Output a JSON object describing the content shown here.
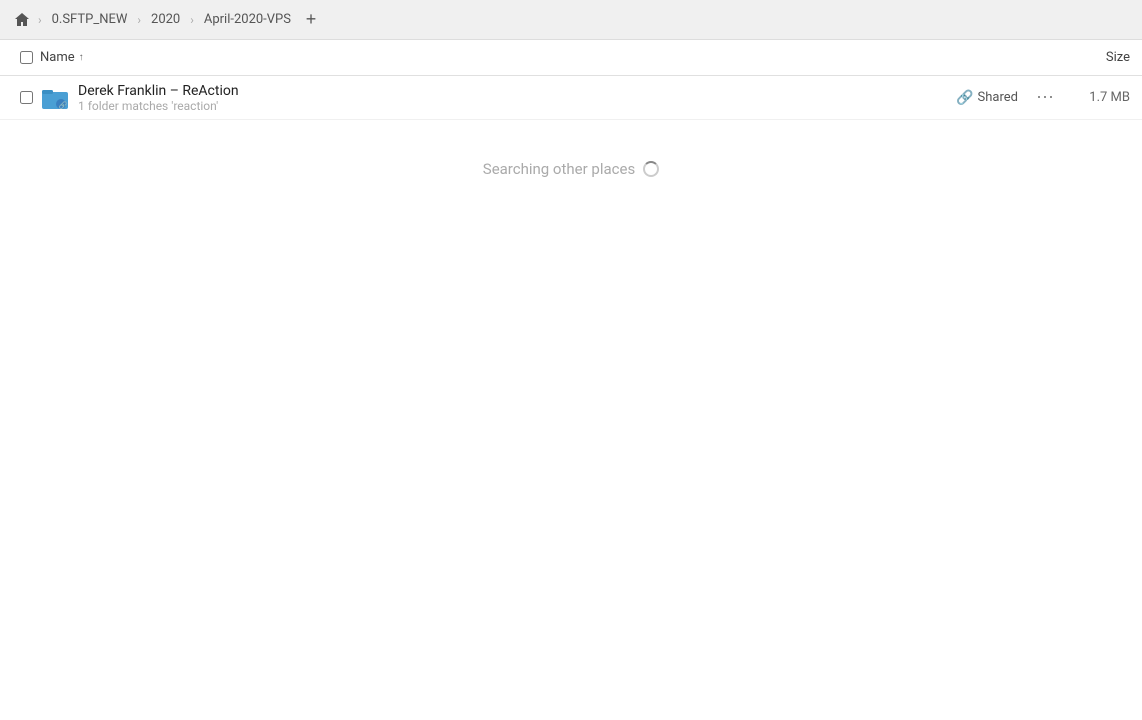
{
  "toolbar": {
    "home_icon": "🏠",
    "breadcrumbs": [
      {
        "label": "0.SFTP_NEW",
        "id": "sftp-new"
      },
      {
        "label": "2020",
        "id": "2020"
      },
      {
        "label": "April-2020-VPS",
        "id": "april-2020-vps"
      }
    ],
    "add_tab_label": "+"
  },
  "columns": {
    "name_label": "Name",
    "sort_arrow": "↑",
    "size_label": "Size"
  },
  "files": [
    {
      "id": "derek-franklin",
      "icon_type": "folder",
      "name": "Derek Franklin – ReAction",
      "sub_text": "1 folder matches 'reaction'",
      "shared": true,
      "shared_label": "Shared",
      "size": "1.7 MB"
    }
  ],
  "search_other": {
    "label": "Searching other places",
    "loading": true
  }
}
